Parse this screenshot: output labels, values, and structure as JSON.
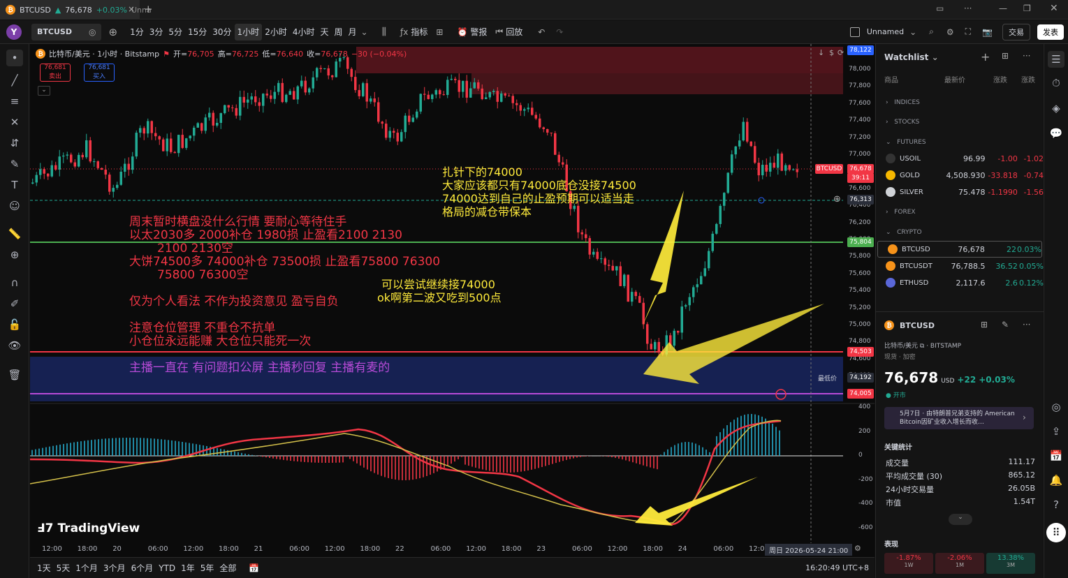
{
  "window": {
    "tab_title": "BTCUSD",
    "tab_price": "76,678",
    "tab_change": "+0.03%",
    "tab_layout": "Unna"
  },
  "toolbar": {
    "avatar": "Y",
    "symbol": "BTCUSD",
    "timeframes": [
      "1分",
      "3分",
      "5分",
      "15分",
      "30分",
      "1小时",
      "2小时",
      "4小时",
      "天",
      "周",
      "月"
    ],
    "active_tf": "1小时",
    "indicators": "指标",
    "alerts": "警报",
    "replay": "回放",
    "layout_name": "Unnamed",
    "trade": "交易",
    "publish": "发表"
  },
  "legend": {
    "name": "比特币/美元 · 1小时 · Bitstamp",
    "open_label": "开=",
    "open": "76,705",
    "high_label": "高=",
    "high": "76,725",
    "low_label": "低=",
    "low": "76,640",
    "close_label": "收=",
    "close": "76,678",
    "chg": "−30 (−0.04%)",
    "sell_price": "76,681",
    "sell": "卖出",
    "buy_price": "76,681",
    "buy": "买入"
  },
  "annotations": {
    "notes": [
      "周末暂时横盘没什么行情 要耐心等待住手",
      "以太2030多 2000补仓 1980损 止盈看2100 2130",
      "2100 2130空",
      "大饼74500多 74000补仓  73500损 止盈看75800 76300",
      "75800 76300空",
      "仅为个人看法 不作为投资意见 盈亏自负",
      "注意仓位管理 不重仓不抗单",
      "小仓位永远能赚 大仓位只能死一次",
      "主播一直在 有问题扣公屏 主播秒回复 主播有麦的"
    ],
    "pin": [
      "扎针下的74000",
      "大家应该都只有74000底仓没接74500",
      "74000达到自己的止盈预期可以适当走",
      "格局的减仓带保本"
    ],
    "second": [
      "可以尝试继续接74000",
      "ok啊第二波又吃到500点"
    ]
  },
  "price_axis": {
    "ticks": [
      "78,000",
      "77,800",
      "77,600",
      "77,400",
      "77,200",
      "77,000",
      "76,800",
      "76,600",
      "76,400",
      "76,200",
      "76,000",
      "75,800",
      "75,600",
      "75,400",
      "75,200",
      "75,000",
      "74,800",
      "74,600",
      "74,400",
      "74,200"
    ],
    "labels": {
      "top": "78,122",
      "btc": "BTCUSD",
      "current": "76,678",
      "countdown": "39:11",
      "crosshair": "76,313",
      "green": "75,804",
      "red": "74,503",
      "low_label": "最低价",
      "low": "74,192",
      "purple": "74,005"
    }
  },
  "macd_axis": [
    "400",
    "200",
    "0",
    "-200",
    "-400",
    "-600"
  ],
  "time_axis": [
    "12:00",
    "18:00",
    "20",
    "06:00",
    "12:00",
    "18:00",
    "21",
    "06:00",
    "12:00",
    "18:00",
    "22",
    "06:00",
    "12:00",
    "18:00",
    "23",
    "06:00",
    "12:00",
    "18:00",
    "24",
    "06:00",
    "12:0"
  ],
  "time_cursor": "周日 2026-05-24   21:00",
  "branding": "TradingView",
  "ranges": [
    "1天",
    "5天",
    "1个月",
    "3个月",
    "6个月",
    "YTD",
    "1年",
    "5年",
    "全部"
  ],
  "clock": "16:20:49 UTC+8",
  "watchlist": {
    "title": "Watchlist",
    "cols": [
      "商品",
      "最新价",
      "涨跌",
      "涨跌"
    ],
    "sections": {
      "indices": "INDICES",
      "stocks": "STOCKS",
      "futures": "FUTURES",
      "forex": "FOREX",
      "crypto": "CRYPTO"
    },
    "futures": [
      {
        "sym": "USOIL",
        "last": "96.99",
        "chg": "-1.00",
        "pct": "-1.02"
      },
      {
        "sym": "GOLD",
        "last": "4,508.930",
        "chg": "-33.818",
        "pct": "-0.74"
      },
      {
        "sym": "SILVER",
        "last": "75.478",
        "chg": "-1.1990",
        "pct": "-1.56"
      }
    ],
    "crypto": [
      {
        "sym": "BTCUSD",
        "last": "76,678",
        "chg": "22",
        "pct": "0.03%"
      },
      {
        "sym": "BTCUSDT",
        "last": "76,788.5",
        "chg": "36.52",
        "pct": "0.05%"
      },
      {
        "sym": "ETHUSD",
        "last": "2,117.6",
        "chg": "2.6",
        "pct": "0.12%"
      }
    ]
  },
  "details": {
    "symbol": "BTCUSD",
    "desc": "比特币/美元",
    "exchange": "BITSTAMP",
    "type": "现货 · 加密",
    "price": "76,678",
    "currency": "USD",
    "change": "+22",
    "change_pct": "+0.03%",
    "status": "开市",
    "news": "5月7日 · 由特朗普兄弟支持的 American Bitcoin因矿业收入增长而收…",
    "key_stats": "关键统计",
    "stats": [
      {
        "k": "成交量",
        "v": "111.17"
      },
      {
        "k": "平均成交量 (30)",
        "v": "865.12"
      },
      {
        "k": "24小时交易量",
        "v": "26.05B"
      },
      {
        "k": "市值",
        "v": "1.54T"
      }
    ],
    "perf": "表现",
    "perf_items": [
      {
        "v": "-1.87%",
        "p": "1W"
      },
      {
        "v": "-2.06%",
        "p": "1M"
      },
      {
        "v": "13.38%",
        "p": "3M"
      }
    ]
  },
  "colors": {
    "up": "#22ab94",
    "down": "#f23645",
    "accent": "#2962ff",
    "annotation_yellow": "#ffeb3b"
  }
}
